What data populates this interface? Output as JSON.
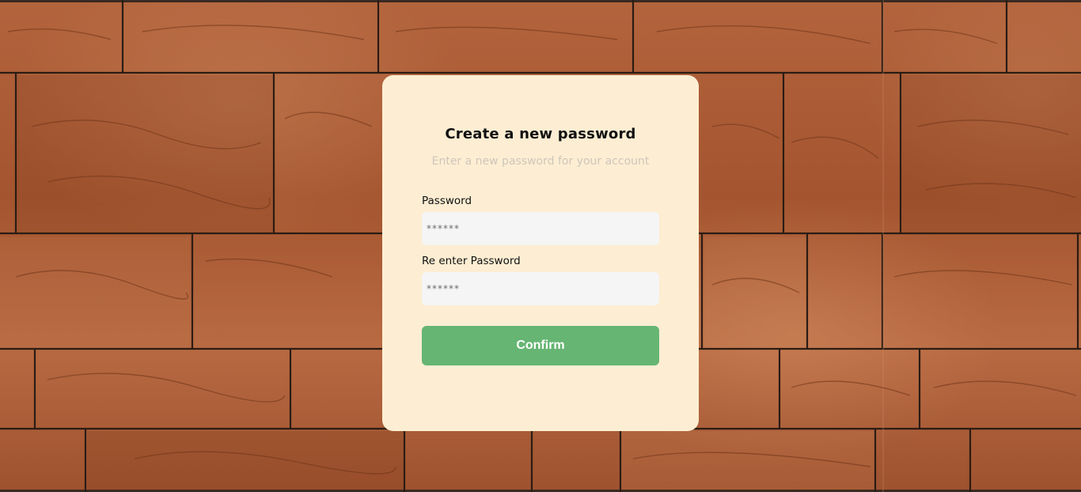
{
  "background": {
    "description_icon": "stone-wall-background",
    "color": "#a85a36"
  },
  "card": {
    "color": "#fdeed3",
    "title": "Create a new password",
    "subtitle": "Enter a new password for your account",
    "password_label": "Password",
    "password_placeholder": "******",
    "reenter_label": "Re enter Password",
    "reenter_placeholder": "******",
    "confirm_label": "Confirm",
    "confirm_color": "#66b573"
  }
}
